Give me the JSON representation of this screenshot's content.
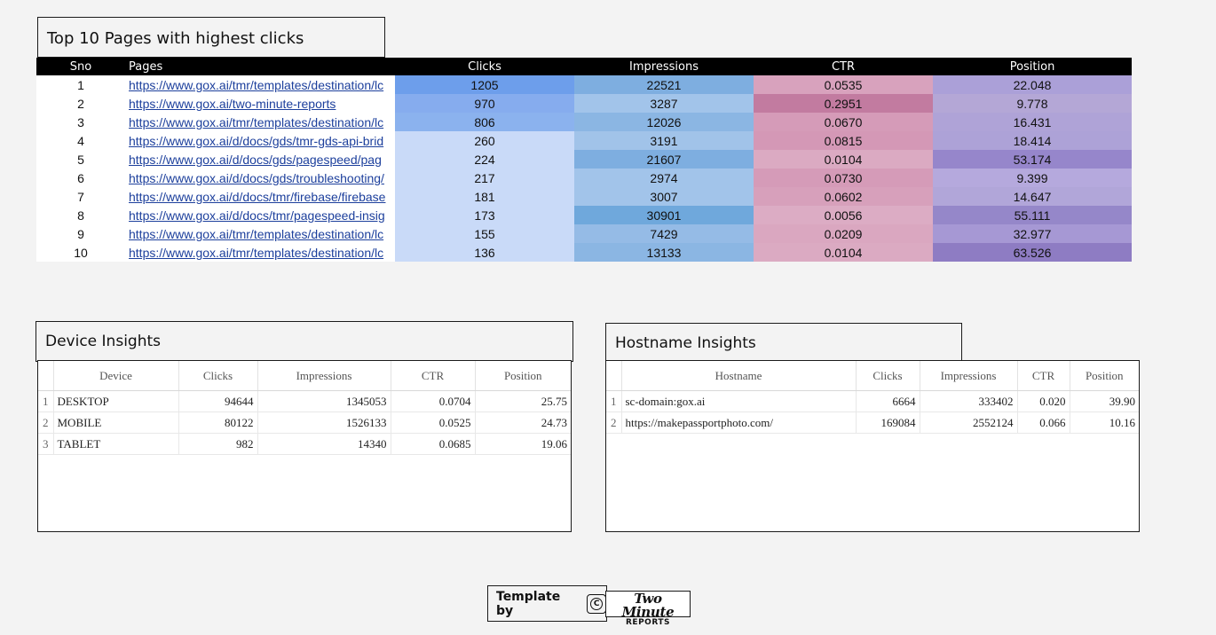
{
  "sections": {
    "top_pages_title": "Top 10 Pages with highest clicks",
    "device_title": "Device Insights",
    "hostname_title": "Hostname Insights"
  },
  "top_pages": {
    "headers": [
      "Sno",
      "Pages",
      "Clicks",
      "Impressions",
      "CTR",
      "Position"
    ],
    "rows": [
      {
        "sno": "1",
        "page": "https://www.gox.ai/tmr/templates/destination/lc",
        "clicks": "1205",
        "impressions": "22521",
        "ctr": "0.0535",
        "position": "22.048"
      },
      {
        "sno": "2",
        "page": "https://www.gox.ai/two-minute-reports",
        "clicks": "970",
        "impressions": "3287",
        "ctr": "0.2951",
        "position": "9.778"
      },
      {
        "sno": "3",
        "page": "https://www.gox.ai/tmr/templates/destination/lc",
        "clicks": "806",
        "impressions": "12026",
        "ctr": "0.0670",
        "position": "16.431"
      },
      {
        "sno": "4",
        "page": "https://www.gox.ai/d/docs/gds/tmr-gds-api-brid",
        "clicks": "260",
        "impressions": "3191",
        "ctr": "0.0815",
        "position": "18.414"
      },
      {
        "sno": "5",
        "page": "https://www.gox.ai/d/docs/gds/pagespeed/pag",
        "clicks": "224",
        "impressions": "21607",
        "ctr": "0.0104",
        "position": "53.174"
      },
      {
        "sno": "6",
        "page": "https://www.gox.ai/d/docs/gds/troubleshooting/",
        "clicks": "217",
        "impressions": "2974",
        "ctr": "0.0730",
        "position": "9.399"
      },
      {
        "sno": "7",
        "page": "https://www.gox.ai/d/docs/tmr/firebase/firebase",
        "clicks": "181",
        "impressions": "3007",
        "ctr": "0.0602",
        "position": "14.647"
      },
      {
        "sno": "8",
        "page": "https://www.gox.ai/d/docs/tmr/pagespeed-insig",
        "clicks": "173",
        "impressions": "30901",
        "ctr": "0.0056",
        "position": "55.111"
      },
      {
        "sno": "9",
        "page": "https://www.gox.ai/tmr/templates/destination/lc",
        "clicks": "155",
        "impressions": "7429",
        "ctr": "0.0209",
        "position": "32.977"
      },
      {
        "sno": "10",
        "page": "https://www.gox.ai/tmr/templates/destination/lc",
        "clicks": "136",
        "impressions": "13133",
        "ctr": "0.0104",
        "position": "63.526"
      }
    ],
    "cell_colors": {
      "clicks": [
        "#6d9eeb",
        "#86acee",
        "#8bb2ee",
        "#c9daf8",
        "#c9daf8",
        "#c9daf8",
        "#c9daf8",
        "#c9daf8",
        "#c9daf8",
        "#c9daf8"
      ],
      "impressions": [
        "#7eaee0",
        "#a2c4ea",
        "#8bb6e3",
        "#a1c3e9",
        "#7eaee0",
        "#a2c4ea",
        "#a2c4ea",
        "#6fa8dc",
        "#95bbe6",
        "#8bb6e3"
      ],
      "ctr": [
        "#d8a2bd",
        "#c27ba0",
        "#d59bb8",
        "#d498b6",
        "#dbaac2",
        "#d59bb8",
        "#d7a0bb",
        "#dcacc4",
        "#daa7c0",
        "#dbaac2"
      ],
      "position": [
        "#aba0d8",
        "#b4a7d6",
        "#afa3d7",
        "#ada2d7",
        "#9686cb",
        "#b5a9dd",
        "#b1a6d9",
        "#9587c9",
        "#a698d4",
        "#8e7cc3"
      ]
    }
  },
  "device": {
    "headers": [
      "Device",
      "Clicks",
      "Impressions",
      "CTR",
      "Position"
    ],
    "rows": [
      {
        "idx": "1",
        "device": "DESKTOP",
        "clicks": "94644",
        "impressions": "1345053",
        "ctr": "0.0704",
        "position": "25.75"
      },
      {
        "idx": "2",
        "device": "MOBILE",
        "clicks": "80122",
        "impressions": "1526133",
        "ctr": "0.0525",
        "position": "24.73"
      },
      {
        "idx": "3",
        "device": "TABLET",
        "clicks": "982",
        "impressions": "14340",
        "ctr": "0.0685",
        "position": "19.06"
      }
    ]
  },
  "hostname": {
    "headers": [
      "Hostname",
      "Clicks",
      "Impressions",
      "CTR",
      "Position"
    ],
    "rows": [
      {
        "idx": "1",
        "hostname": "sc-domain:gox.ai",
        "clicks": "6664",
        "impressions": "333402",
        "ctr": "0.020",
        "position": "39.90"
      },
      {
        "idx": "2",
        "hostname": "https://makepassportphoto.com/",
        "clicks": "169084",
        "impressions": "2552124",
        "ctr": "0.066",
        "position": "10.16"
      }
    ]
  },
  "footer": {
    "template_by": "Template by",
    "copyright_glyph": "C",
    "logo_line1": "Two Minute",
    "logo_line2": "REPORTS"
  }
}
